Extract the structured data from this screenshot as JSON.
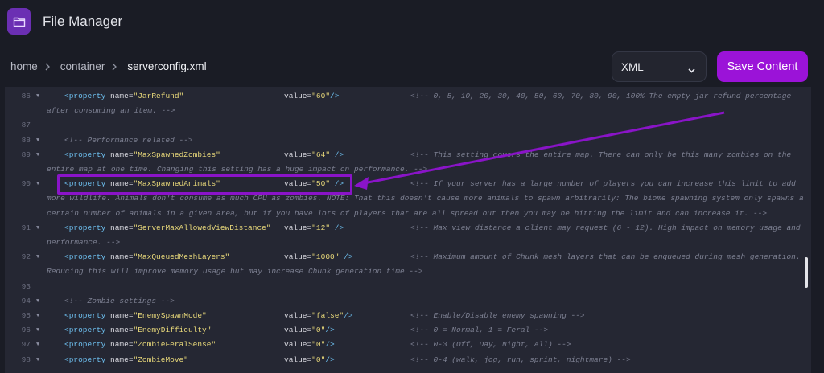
{
  "app": {
    "title": "File Manager",
    "icon": "folder-icon",
    "accent": "#9b13d8"
  },
  "breadcrumb": [
    "home",
    "container",
    "serverconfig.xml"
  ],
  "toolbar": {
    "language": "XML",
    "save_label": "Save Content"
  },
  "lines": [
    {
      "num": "86",
      "fold": true,
      "indent": true,
      "name": "JarRefund",
      "value": "60",
      "close": "/>",
      "comment": "<!-- 0, 5, 10, 20, 30, 40, 50, 60, 70, 80, 90, 100% The empty jar refund percentage",
      "continuation": [
        "after consuming an item. -->"
      ]
    },
    {
      "num": "87"
    },
    {
      "num": "88",
      "fold": true,
      "comment_only": "<!-- Performance related -->"
    },
    {
      "num": "89",
      "fold": true,
      "indent": true,
      "name": "MaxSpawnedZombies",
      "value": "64",
      "close": " />",
      "comment": "<!-- This setting covers the entire map. There can only be this many zombies on the",
      "continuation": [
        "entire map at one time. Changing this setting has a huge impact on performance. -->"
      ]
    },
    {
      "num": "90",
      "fold": true,
      "indent": true,
      "name": "MaxSpawnedAnimals",
      "value": "50",
      "close": " />",
      "comment": "<!-- If your server has a large number of players you can increase this limit to add",
      "continuation": [
        "more wildlife. Animals don't consume as much CPU as zombies. NOTE: That this doesn't cause more animals to spawn arbitrarily: The biome spawning system only spawns a",
        "certain number of animals in a given area, but if you have lots of players that are all spread out then you may be hitting the limit and can increase it. -->"
      ]
    },
    {
      "num": "91",
      "fold": true,
      "indent": true,
      "name": "ServerMaxAllowedViewDistance",
      "value": "12",
      "close": " />",
      "comment": "<!-- Max view distance a client may request (6 - 12). High impact on memory usage and",
      "continuation": [
        "performance. -->"
      ]
    },
    {
      "num": "92",
      "fold": true,
      "indent": true,
      "name": "MaxQueuedMeshLayers",
      "value": "1000",
      "close": " />",
      "comment": "<!-- Maximum amount of Chunk mesh layers that can be enqueued during mesh generation.",
      "continuation": [
        "Reducing this will improve memory usage but may increase Chunk generation time -->"
      ]
    },
    {
      "num": "93"
    },
    {
      "num": "94",
      "fold": true,
      "comment_only": "<!-- Zombie settings -->"
    },
    {
      "num": "95",
      "fold": true,
      "indent": true,
      "name": "EnemySpawnMode",
      "value": "false",
      "close": "/>",
      "comment": "<!-- Enable/Disable enemy spawning -->"
    },
    {
      "num": "96",
      "fold": true,
      "indent": true,
      "name": "EnemyDifficulty",
      "value": "0",
      "close": "/>",
      "comment": "<!-- 0 = Normal, 1 = Feral -->"
    },
    {
      "num": "97",
      "fold": true,
      "indent": true,
      "name": "ZombieFeralSense",
      "value": "0",
      "close": "/>",
      "comment": "<!-- 0-3 (Off, Day, Night, All) -->"
    },
    {
      "num": "98",
      "fold": true,
      "indent": true,
      "name": "ZombieMove",
      "value": "0",
      "close": "/>",
      "comment": "<!-- 0-4 (walk, jog, run, sprint, nightmare) -->"
    }
  ]
}
